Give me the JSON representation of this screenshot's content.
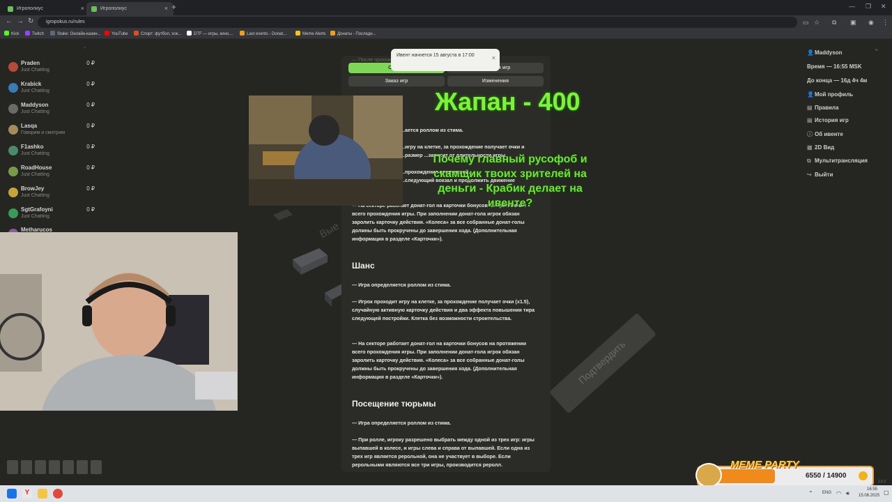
{
  "browser": {
    "tabs": [
      {
        "label": "Игрополиус"
      },
      {
        "label": "Игрополиус"
      }
    ],
    "new_tab": "+",
    "url": "igropokus.ru/rules",
    "bookmarks": [
      {
        "label": "Kick",
        "color": "#53fc18"
      },
      {
        "label": "Twitch",
        "color": "#9146ff"
      },
      {
        "label": "Stake: Онлайн-казин...",
        "color": "#1a2c38"
      },
      {
        "label": "YouTube",
        "color": "#ff0000"
      },
      {
        "label": "Спорт: футбол, хок...",
        "color": "#e04e1a"
      },
      {
        "label": "DTF — игры, кино,...",
        "color": "#ffffff"
      },
      {
        "label": "Last events - Donat...",
        "color": "#f59c1a"
      },
      {
        "label": "Meme Alerts",
        "color": "#f5c21a"
      },
      {
        "label": "Донаты - Последн...",
        "color": "#f59c1a"
      }
    ]
  },
  "left_list": [
    {
      "name": "Praden",
      "sub": "Just Chatting",
      "value": "0 ₽",
      "avatar": "#b54a3a"
    },
    {
      "name": "Krabick",
      "sub": "Just Chatting",
      "value": "0 ₽",
      "avatar": "#3a7ab5"
    },
    {
      "name": "Maddyson",
      "sub": "Just Chatting",
      "value": "0 ₽",
      "avatar": "#6a6a6a"
    },
    {
      "name": "Lasqa",
      "sub": "Говорим и смотрим",
      "value": "0 ₽",
      "avatar": "#a58a5a"
    },
    {
      "name": "F1ashko",
      "sub": "Just Chatting",
      "value": "0 ₽",
      "avatar": "#4a8a6a"
    },
    {
      "name": "RoadHouse",
      "sub": "Just Chatting",
      "value": "0 ₽",
      "avatar": "#7a9a4a"
    },
    {
      "name": "BrowJey",
      "sub": "Just Chatting",
      "value": "0 ₽",
      "avatar": "#c5a53a"
    },
    {
      "name": "SgtGrafoyni",
      "sub": "Just Chatting",
      "value": "0 ₽",
      "avatar": "#3a9a5a"
    },
    {
      "name": "Metharucos",
      "sub": "",
      "value": "",
      "avatar": "#8a5a9a"
    }
  ],
  "toast": {
    "text": "Ивент начнется 15 августа в 17:00",
    "close": "×"
  },
  "card_buttons": {
    "general": "Общие",
    "history": "История игр",
    "order": "Заказ игр",
    "changes": "Изменения"
  },
  "card_faint": "— После прохождения... ...игру из...",
  "rules": {
    "intro_lines": [
      "...ается роллом из стима.",
      "...игру на клетке, за прохождение получает очки и ...размер ...зависит от длительности игры.",
      "...прохождения следующей...",
      "...следующий вокзал и продолжить движение"
    ],
    "block1": "— На секторе работает донат-гол на карточки бонусов на протяжении всего прохождения игры. При заполнении донат-гола игрок обязан заролить карточку действия. «Колеса» за все собранные донат-голы должны быть прокручены до завершения хода. (Дополнительная информация в разделе «Карточки»).",
    "chance_title": "Шанс",
    "chance_p1": "— Игра определяется роллом из стима.",
    "chance_p2": "— Игрок проходит игру на клетке, за прохождение получает очки (x1.5), случайную активную карточку действия и два эффекта повышения тира следующей постройки. Клетка без возможности строительства.",
    "chance_p3": "— На секторе работает донат-гол на карточки бонусов на протяжении всего прохождения игры. При заполнении донат-гола игрок обязан заролить карточку действия. «Колеса» за все собранные донат-голы должны быть прокручены до завершения хода. (Дополнительная информация в разделе «Карточки»).",
    "prison_title": "Посещение тюрьмы",
    "prison_p1": "— Игра определяется роллом из стима.",
    "prison_p2": "— При ролле, игроку разрешено выбрать между одной из трех игр: игры выпавшей в колесе, и игры слева и справа от выпавшей. Если одна из трех игр является рерольной, она не участвует в выборе. Если рерольными являются все три игры, производится реролл."
  },
  "overlays": {
    "japan": "Жапан - 400",
    "question": "Почему главный русофоб и скамщик твоих зрителей на деньги - Крабик делает на ивенте?",
    "board_text": "Вые"
  },
  "right_sidebar": {
    "user": "Maddyson",
    "time": "Время — 16:55 MSK",
    "left": "До конца — 16д 4ч 4м",
    "items": [
      {
        "icon": "user-icon",
        "glyph": "👤",
        "label": "Мой профиль"
      },
      {
        "icon": "doc-icon",
        "glyph": "▤",
        "label": "Правила"
      },
      {
        "icon": "history-icon",
        "glyph": "▤",
        "label": "История игр"
      },
      {
        "icon": "info-icon",
        "glyph": "ⓘ",
        "label": "Об ивенте"
      },
      {
        "icon": "grid-icon",
        "glyph": "▦",
        "label": "2D Вид"
      },
      {
        "icon": "multi-icon",
        "glyph": "⧉",
        "label": "Мультитрансляция"
      },
      {
        "icon": "logout-icon",
        "glyph": "↪",
        "label": "Выйти"
      }
    ]
  },
  "confirm": "Подтвердить",
  "meme_party": {
    "title": "MEME PARTY",
    "count": "6550 / 14900",
    "progress": 0.44,
    "version": "1.0.2"
  },
  "taskbar": {
    "lang": "ENG",
    "time": "16:55",
    "date": "15.08.2025"
  }
}
